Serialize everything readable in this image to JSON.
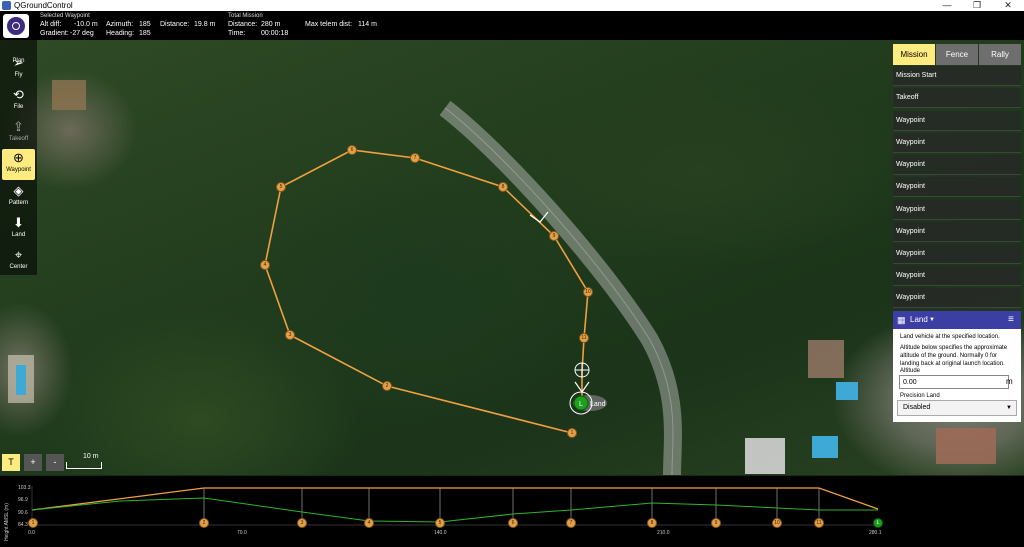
{
  "window": {
    "title": "QGroundControl",
    "buttons": [
      "—",
      "❐",
      "✕"
    ]
  },
  "status": {
    "selected_waypoint_header": "Selected Waypoint",
    "alt_diff_label": "Alt diff:",
    "alt_diff_value": "-10.0 m",
    "gradient_label": "Gradient:",
    "gradient_value": "-27 deg",
    "azimuth_label": "Azimuth:",
    "azimuth_value": "185",
    "heading_label": "Heading:",
    "heading_value": "185",
    "distance_label": "Distance:",
    "distance_value": "19.8 m",
    "total_mission_header": "Total Mission",
    "total_distance_label": "Distance:",
    "total_distance_value": "280 m",
    "time_label": "Time:",
    "time_value": "00:00:18",
    "max_telem_label": "Max telem dist:",
    "max_telem_value": "114 m"
  },
  "toolbar": {
    "tools": [
      {
        "label": "Plan",
        "icon": "plan-icon"
      },
      {
        "label": "Fly",
        "icon": "paper-plane-icon"
      },
      {
        "label": "File",
        "icon": "file-sync-icon"
      },
      {
        "label": "Takeoff",
        "icon": "takeoff-icon",
        "disabled": true
      },
      {
        "label": "Waypoint",
        "icon": "plus-circle-icon",
        "active": true
      },
      {
        "label": "Pattern",
        "icon": "pattern-icon"
      },
      {
        "label": "Land",
        "icon": "land-icon"
      },
      {
        "label": "Center",
        "icon": "crosshair-icon"
      }
    ]
  },
  "mission_panel": {
    "tabs": [
      {
        "label": "Mission",
        "active": true
      },
      {
        "label": "Fence"
      },
      {
        "label": "Rally"
      }
    ],
    "items": [
      "Mission Start",
      "Takeoff",
      "Waypoint",
      "Waypoint",
      "Waypoint",
      "Waypoint",
      "Waypoint",
      "Waypoint",
      "Waypoint",
      "Waypoint",
      "Waypoint"
    ],
    "editor": {
      "title": "Land",
      "description": "Land vehicle at the specified location.",
      "altitude_note": "Altitude below specifies the approximate altitude of the ground. Normally 0 for landing back at original launch location.",
      "altitude_label": "Altitude",
      "altitude_value": "0.00",
      "altitude_unit": "m",
      "precision_label": "Precision Land",
      "precision_value": "Disabled"
    }
  },
  "map": {
    "land_label": "Land",
    "land_marker": "L",
    "scale": "10 m",
    "map_controls": [
      "T",
      "+",
      "-"
    ],
    "waypoints": [
      "1",
      "2",
      "3",
      "4",
      "5",
      "6",
      "7",
      "8",
      "9",
      "10",
      "11"
    ],
    "colors": {
      "mission_line": "#f0a040",
      "active": "#ffeb80",
      "land": "#1ea01e"
    }
  },
  "profile": {
    "y_axis_label": "Height AMSL (m)",
    "y_ticks": [
      "103.3",
      "96.9",
      "90.6",
      "84.3"
    ],
    "x_ticks": [
      "0.0",
      "70.0",
      "140.0",
      "210.0",
      "280.1"
    ],
    "markers": [
      "1",
      "2",
      "3",
      "4",
      "5",
      "6",
      "7",
      "8",
      "9",
      "10",
      "11",
      "12",
      "13"
    ]
  }
}
